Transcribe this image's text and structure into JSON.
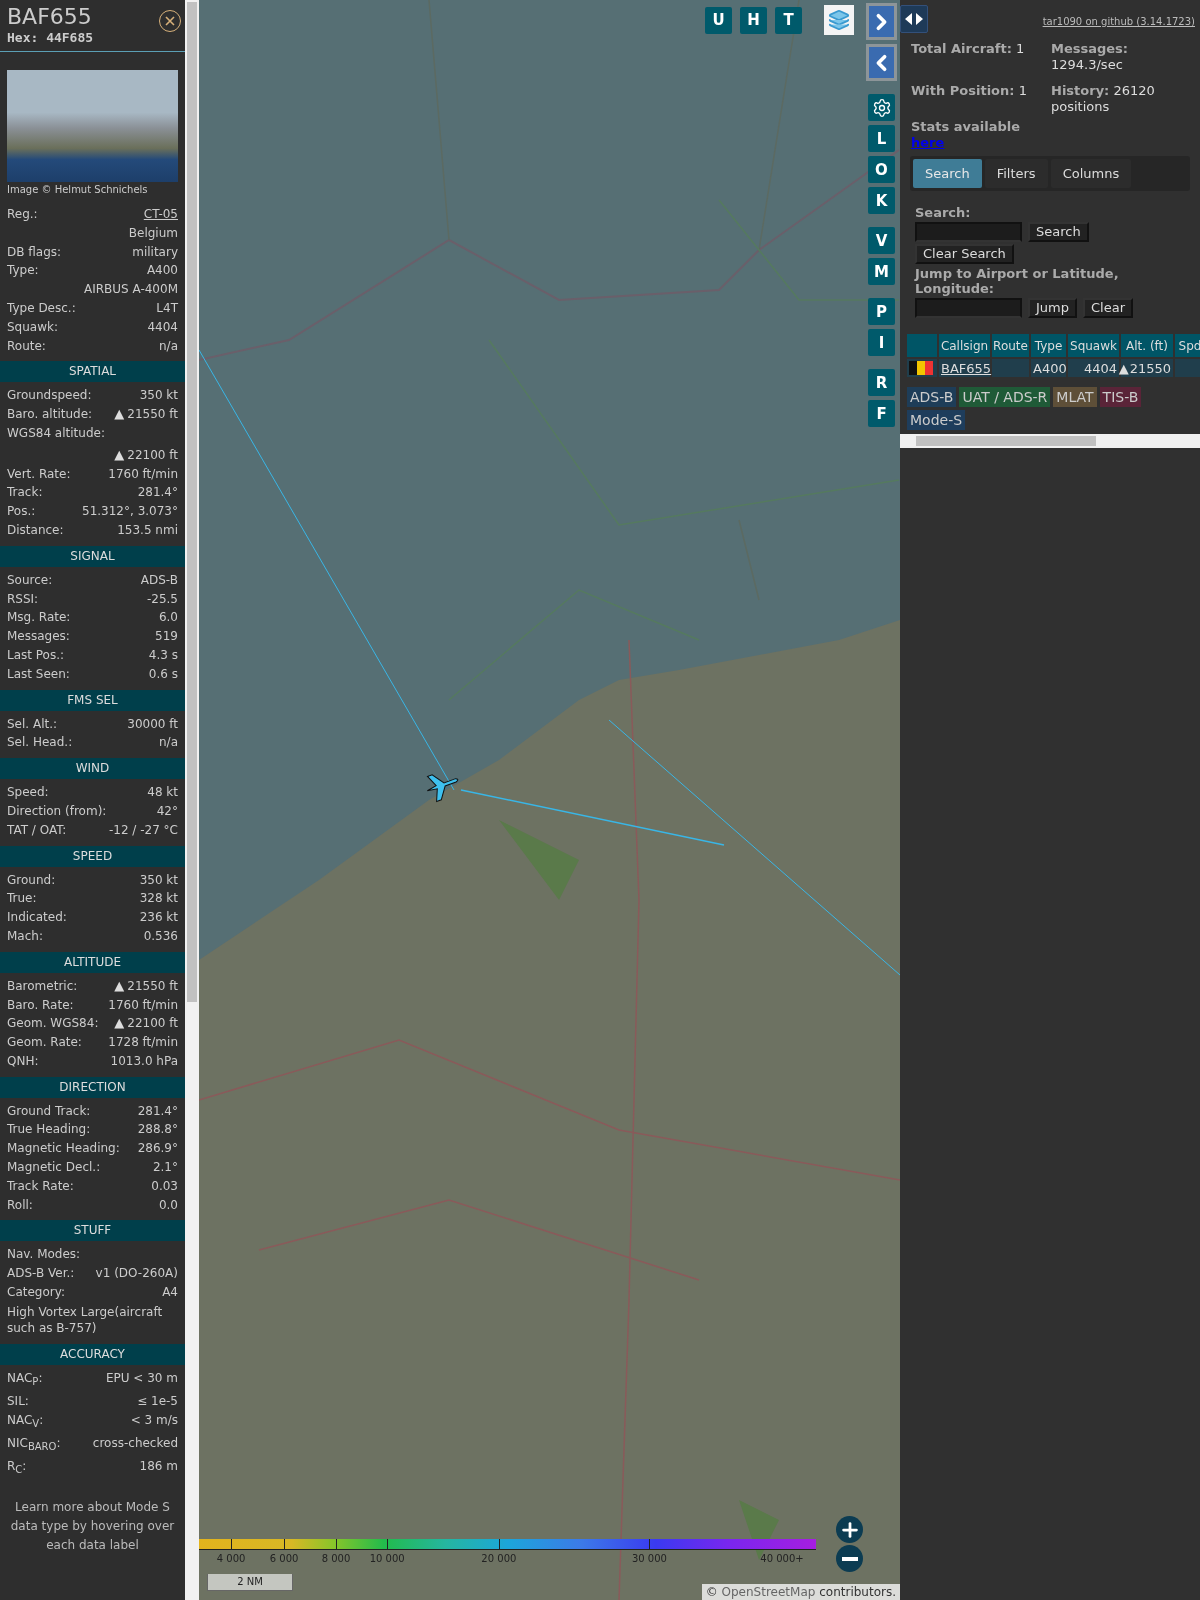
{
  "detail": {
    "callsign": "BAF655",
    "hex": "Hex: 44F685",
    "photo_credit": "Image © Helmut Schnichels",
    "info_rows": [
      {
        "label": "Reg.:",
        "value": "CT-05",
        "kind": "link"
      },
      {
        "value": "Belgium",
        "kind": "value"
      },
      {
        "label": "DB flags:",
        "value": "military",
        "kind": "pair"
      },
      {
        "label": "Type:",
        "value": "A400",
        "kind": "pair"
      },
      {
        "value": "AIRBUS A-400M",
        "kind": "value"
      },
      {
        "label": "Type Desc.:",
        "value": "L4T",
        "kind": "pair"
      },
      {
        "label": "Squawk:",
        "value": "4404",
        "kind": "pair"
      },
      {
        "label": "Route:",
        "value": "n/a",
        "kind": "pair"
      }
    ],
    "sections": [
      {
        "title": "SPATIAL",
        "rows": [
          {
            "label": "Groundspeed:",
            "value": "350 kt",
            "kind": "pair"
          },
          {
            "label": "Baro. altitude:",
            "value": "21550 ft",
            "kind": "pair",
            "trend": "▲"
          },
          {
            "label": "WGS84 altitude:",
            "value": "22100 ft",
            "kind": "stacked",
            "trend": "▲"
          },
          {
            "label": "Vert. Rate:",
            "value": "1760 ft/min",
            "kind": "pair"
          },
          {
            "label": "Track:",
            "value": "281.4°",
            "kind": "pair"
          },
          {
            "label": "Pos.:",
            "value": "51.312°, 3.073°",
            "kind": "pair"
          },
          {
            "label": "Distance:",
            "value": "153.5 nmi",
            "kind": "pair"
          }
        ]
      },
      {
        "title": "SIGNAL",
        "rows": [
          {
            "label": "Source:",
            "value": "ADS-B",
            "kind": "pair"
          },
          {
            "label": "RSSI:",
            "value": "-25.5",
            "kind": "pair"
          },
          {
            "label": "Msg. Rate:",
            "value": "6.0",
            "kind": "pair"
          },
          {
            "label": "Messages:",
            "value": "519",
            "kind": "pair"
          },
          {
            "label": "Last Pos.:",
            "value": "4.3 s",
            "kind": "pair"
          },
          {
            "label": "Last Seen:",
            "value": "0.6 s",
            "kind": "pair"
          }
        ]
      },
      {
        "title": "FMS SEL",
        "rows": [
          {
            "label": "Sel. Alt.:",
            "value": "30000 ft",
            "kind": "pair"
          },
          {
            "label": "Sel. Head.:",
            "value": "n/a",
            "kind": "pair"
          }
        ]
      },
      {
        "title": "WIND",
        "rows": [
          {
            "label": "Speed:",
            "value": "48 kt",
            "kind": "pair"
          },
          {
            "label": "Direction (from):",
            "value": "42°",
            "kind": "pair"
          },
          {
            "label": "TAT / OAT:",
            "value": "-12 / -27 °C",
            "kind": "pair"
          }
        ]
      },
      {
        "title": "SPEED",
        "rows": [
          {
            "label": "Ground:",
            "value": "350 kt",
            "kind": "pair"
          },
          {
            "label": "True:",
            "value": "328 kt",
            "kind": "pair"
          },
          {
            "label": "Indicated:",
            "value": "236 kt",
            "kind": "pair"
          },
          {
            "label": "Mach:",
            "value": "0.536",
            "kind": "pair"
          }
        ]
      },
      {
        "title": "ALTITUDE",
        "rows": [
          {
            "label": "Barometric:",
            "value": "21550 ft",
            "kind": "pair",
            "trend": "▲"
          },
          {
            "label": "Baro. Rate:",
            "value": "1760 ft/min",
            "kind": "pair"
          },
          {
            "label": "Geom. WGS84:",
            "value": "22100 ft",
            "kind": "pair",
            "trend": "▲"
          },
          {
            "label": "Geom. Rate:",
            "value": "1728 ft/min",
            "kind": "pair"
          },
          {
            "label": "QNH:",
            "value": "1013.0 hPa",
            "kind": "pair"
          }
        ]
      },
      {
        "title": "DIRECTION",
        "rows": [
          {
            "label": "Ground Track:",
            "value": "281.4°",
            "kind": "pair"
          },
          {
            "label": "True Heading:",
            "value": "288.8°",
            "kind": "pair"
          },
          {
            "label": "Magnetic Heading:",
            "value": "286.9°",
            "kind": "pair"
          },
          {
            "label": "Magnetic Decl.:",
            "value": "2.1°",
            "kind": "pair"
          },
          {
            "label": "Track Rate:",
            "value": "0.03",
            "kind": "pair"
          },
          {
            "label": "Roll:",
            "value": "0.0",
            "kind": "pair"
          }
        ]
      },
      {
        "title": "STUFF",
        "rows": [
          {
            "label": "Nav. Modes:",
            "kind": "label"
          },
          {
            "label": "ADS-B Ver.:",
            "value": "v1 (DO-260A)",
            "kind": "pair"
          },
          {
            "label": "Category:",
            "value": "A4",
            "kind": "pair"
          },
          {
            "value": "High Vortex Large(aircraft such as B-757)",
            "kind": "text"
          }
        ]
      },
      {
        "title": "ACCURACY",
        "rows": [
          {
            "label": "NAC$_{P}$:",
            "value": "EPU < 30 m",
            "kind": "pair"
          },
          {
            "label": "SIL:",
            "value": "≤ 1e-5",
            "kind": "pair"
          },
          {
            "label": "NAC$_{V}$:",
            "value": "< 3 m/s",
            "kind": "pair"
          },
          {
            "label": "NIC$_{BARO}$:",
            "value": "cross-checked",
            "kind": "pair"
          },
          {
            "label": "R$_{C}$:",
            "value": "186 m",
            "kind": "pair"
          }
        ]
      }
    ],
    "footer": "Learn more about Mode S data type by hovering over each data label"
  },
  "map": {
    "top_buttons": [
      "U",
      "H",
      "T"
    ],
    "side_groups": [
      [
        {
          "kind": "next"
        },
        {
          "kind": "prev"
        }
      ],
      [
        {
          "kind": "settings"
        },
        {
          "kind": "letter",
          "label": "L"
        },
        {
          "kind": "letter",
          "label": "O"
        },
        {
          "kind": "letter",
          "label": "K"
        }
      ],
      [
        {
          "kind": "letter",
          "label": "V"
        },
        {
          "kind": "letter",
          "label": "M"
        }
      ],
      [
        {
          "kind": "letter",
          "label": "P"
        },
        {
          "kind": "letter",
          "label": "I"
        }
      ],
      [
        {
          "kind": "letter",
          "label": "R"
        },
        {
          "kind": "letter",
          "label": "F"
        }
      ]
    ],
    "altitude_legend": [
      "4 000",
      "6 000",
      "8 000",
      "10 000",
      "20 000",
      "30 000",
      "40 000+"
    ],
    "scale": "2 NM",
    "attribution": {
      "prefix": "©",
      "link": "OpenStreetMap",
      "suffix": "contributors."
    }
  },
  "sidebar": {
    "github_link": "tar1090 on github (3.14.1723)",
    "stats": [
      {
        "label": "Total Aircraft:",
        "value": "1"
      },
      {
        "label": "Messages:",
        "value": "1294.3/sec"
      },
      {
        "label": "With Position:",
        "value": "1"
      },
      {
        "label": "History:",
        "value": "26120 positions"
      }
    ],
    "stats_text": "Stats available",
    "stats_link": "here",
    "tabs": [
      {
        "label": "Search",
        "selected": true
      },
      {
        "label": "Filters",
        "selected": false
      },
      {
        "label": "Columns",
        "selected": false
      }
    ],
    "search_label": "Search:",
    "search_button": "Search",
    "clear_search_button": "Clear Search",
    "jump_label": "Jump to Airport or Latitude, Longitude:",
    "jump_button": "Jump",
    "clear_button": "Clear",
    "table": {
      "columns": [
        "Callsign",
        "Route",
        "Type",
        "Squawk",
        "Alt. (ft)",
        "Spd"
      ],
      "rows": [
        {
          "callsign": "BAF655",
          "type": "A400",
          "squawk": "4404",
          "altitude": "21550",
          "trend": "▲"
        }
      ]
    },
    "sources": [
      {
        "label": "ADS-B",
        "color": "#1e3d58"
      },
      {
        "label": "UAT / ADS-R",
        "color": "#1f5a37"
      },
      {
        "label": "MLAT",
        "color": "#5e4f38"
      },
      {
        "label": "TIS-B",
        "color": "#5a2438"
      },
      {
        "label": "Mode-S",
        "color": "#1e3d5c"
      }
    ]
  }
}
